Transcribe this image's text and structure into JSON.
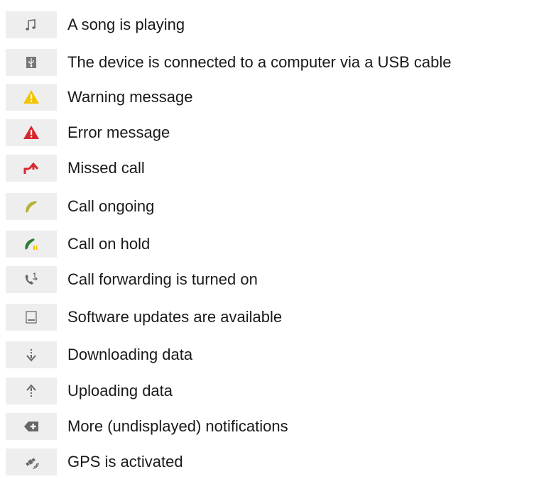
{
  "rows": [
    {
      "icon": "music-note-icon",
      "label": "A song is playing"
    },
    {
      "icon": "usb-icon",
      "label": "The device is connected to a computer via a USB cable"
    },
    {
      "icon": "warning-icon",
      "label": "Warning message",
      "color": "#f5c400"
    },
    {
      "icon": "error-icon",
      "label": "Error message",
      "color": "#d7282f"
    },
    {
      "icon": "missed-call-icon",
      "label": "Missed call",
      "color": "#d7282f"
    },
    {
      "icon": "call-ongoing-icon",
      "label": "Call ongoing",
      "color": "#b5b23a"
    },
    {
      "icon": "call-on-hold-icon",
      "label": "Call on hold",
      "color": "#2e7d32"
    },
    {
      "icon": "call-forwarding-icon",
      "label": "Call forwarding is turned on"
    },
    {
      "icon": "software-update-icon",
      "label": "Software updates are available"
    },
    {
      "icon": "download-icon",
      "label": "Downloading data"
    },
    {
      "icon": "upload-icon",
      "label": "Uploading data"
    },
    {
      "icon": "more-notifications-icon",
      "label": "More (undisplayed) notifications"
    },
    {
      "icon": "gps-icon",
      "label": "GPS is activated"
    }
  ]
}
